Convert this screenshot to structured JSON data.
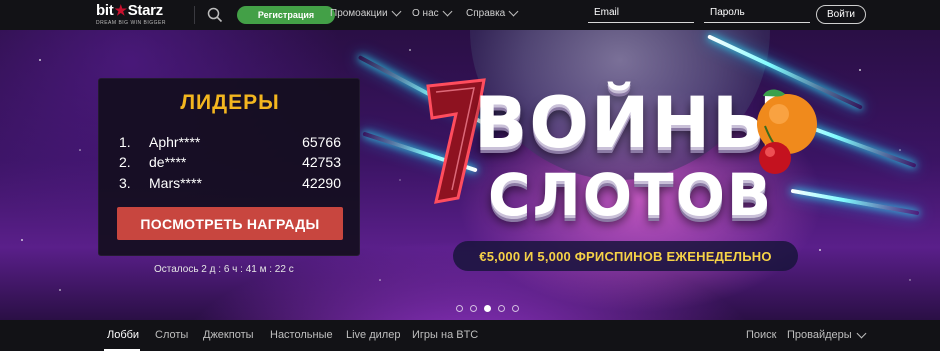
{
  "header": {
    "logo": {
      "text_left": "bit",
      "text_right": "Starz",
      "tagline": "DREAM BIG WIN BIGGER"
    },
    "register_label": "Регистрация",
    "nav": [
      {
        "label": "Промоакции"
      },
      {
        "label": "О нас"
      },
      {
        "label": "Справка"
      }
    ],
    "email_placeholder": "Email",
    "password_placeholder": "Пароль",
    "login_label": "Войти"
  },
  "leaders": {
    "title": "ЛИДЕРЫ",
    "rows": [
      {
        "rank": "1.",
        "name": "Aphr****",
        "score": "65766"
      },
      {
        "rank": "2.",
        "name": "de****",
        "score": "42753"
      },
      {
        "rank": "3.",
        "name": "Mars****",
        "score": "42290"
      }
    ],
    "button_label": "ПОСМОТРЕТЬ НАГРАДЫ",
    "timer": "Осталось 2 д : 6 ч : 41 м : 22 с"
  },
  "promo": {
    "line1": "ВОЙНЫ",
    "line2": "СЛОТОВ",
    "subtitle": "€5,000 И 5,000 ФРИСПИНОВ ЕЖЕНЕДЕЛЬНО"
  },
  "carousel": {
    "count": 5,
    "active": 3
  },
  "categories": {
    "tabs": [
      {
        "label": "Лобби"
      },
      {
        "label": "Слоты"
      },
      {
        "label": "Джекпоты"
      },
      {
        "label": "Настольные"
      },
      {
        "label": "Live дилер"
      },
      {
        "label": "Игры на BTC"
      }
    ],
    "search_label": "Поиск",
    "providers_label": "Провайдеры"
  },
  "colors": {
    "accent_green": "#43a047",
    "accent_gold": "#f3b61f",
    "cta_red": "#c8463f"
  },
  "icons": [
    "search-icon",
    "chevron-down-icon",
    "star-icon"
  ]
}
